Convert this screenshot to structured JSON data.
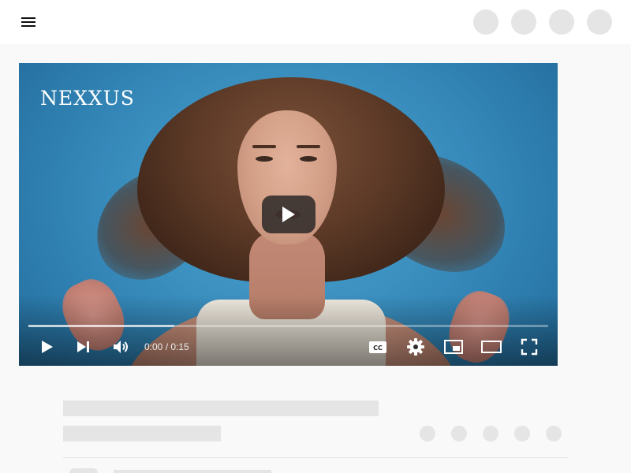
{
  "header": {
    "menu_icon": "hamburger-menu-icon",
    "placeholder_buttons": 4
  },
  "player": {
    "brand_text": "NEXXUS",
    "time_display": "0:00 / 0:15",
    "loaded_fraction": 0.28,
    "played_fraction": 0.0,
    "icons": {
      "big_play": "play-icon",
      "play": "play-icon",
      "next": "skip-next-icon",
      "volume": "volume-icon",
      "captions": "captions-icon",
      "settings": "gear-icon",
      "miniplayer": "miniplayer-icon",
      "theater": "theater-mode-icon",
      "fullscreen": "fullscreen-icon"
    }
  },
  "colors": {
    "page_background": "#f9f9f9",
    "skeleton": "#e5e5e5",
    "progress_played": "#ff0000"
  }
}
